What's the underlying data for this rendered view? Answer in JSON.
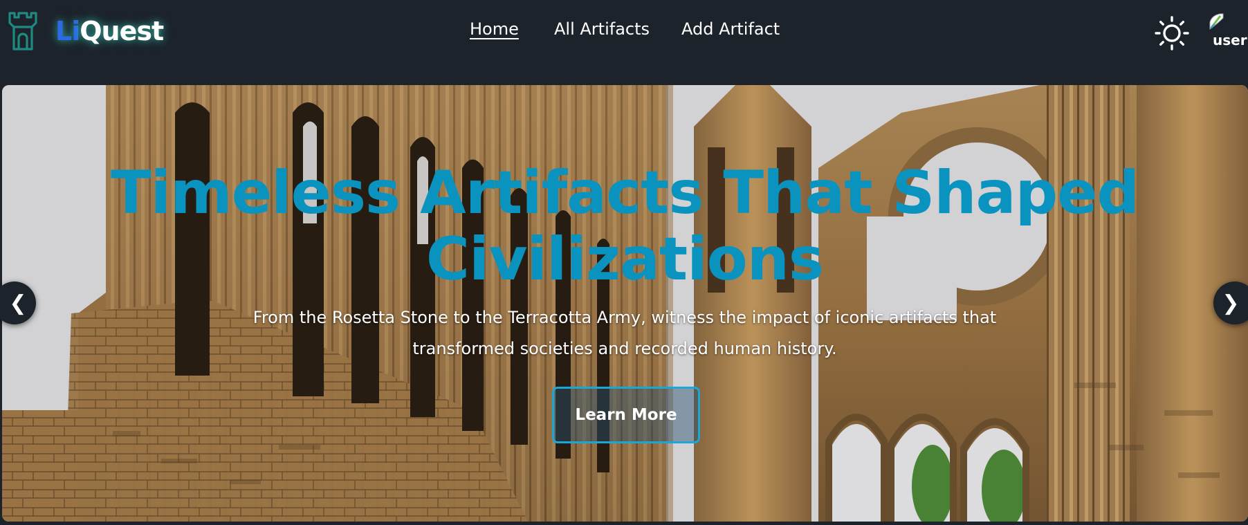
{
  "brand": {
    "li": "Li",
    "quest": "Quest",
    "icon": "castle-tower-icon",
    "accent": "#2b6be8",
    "icon_color": "#1e8a82"
  },
  "nav": {
    "items": [
      {
        "label": "Home",
        "active": true
      },
      {
        "label": "All Artifacts",
        "active": false
      },
      {
        "label": "Add Artifact",
        "active": false
      }
    ]
  },
  "header": {
    "theme_icon": "sun-icon",
    "user_label": "user",
    "avatar_icon": "broken-image-icon"
  },
  "hero": {
    "title": "Timeless Artifacts That Shaped Civilizations",
    "description": "From the Rosetta Stone to the Terracotta Army, witness the impact of iconic artifacts that transformed societies and recorded human history.",
    "button_label": "Learn More",
    "prev_label": "❮",
    "next_label": "❯",
    "title_color": "#0a93be"
  }
}
